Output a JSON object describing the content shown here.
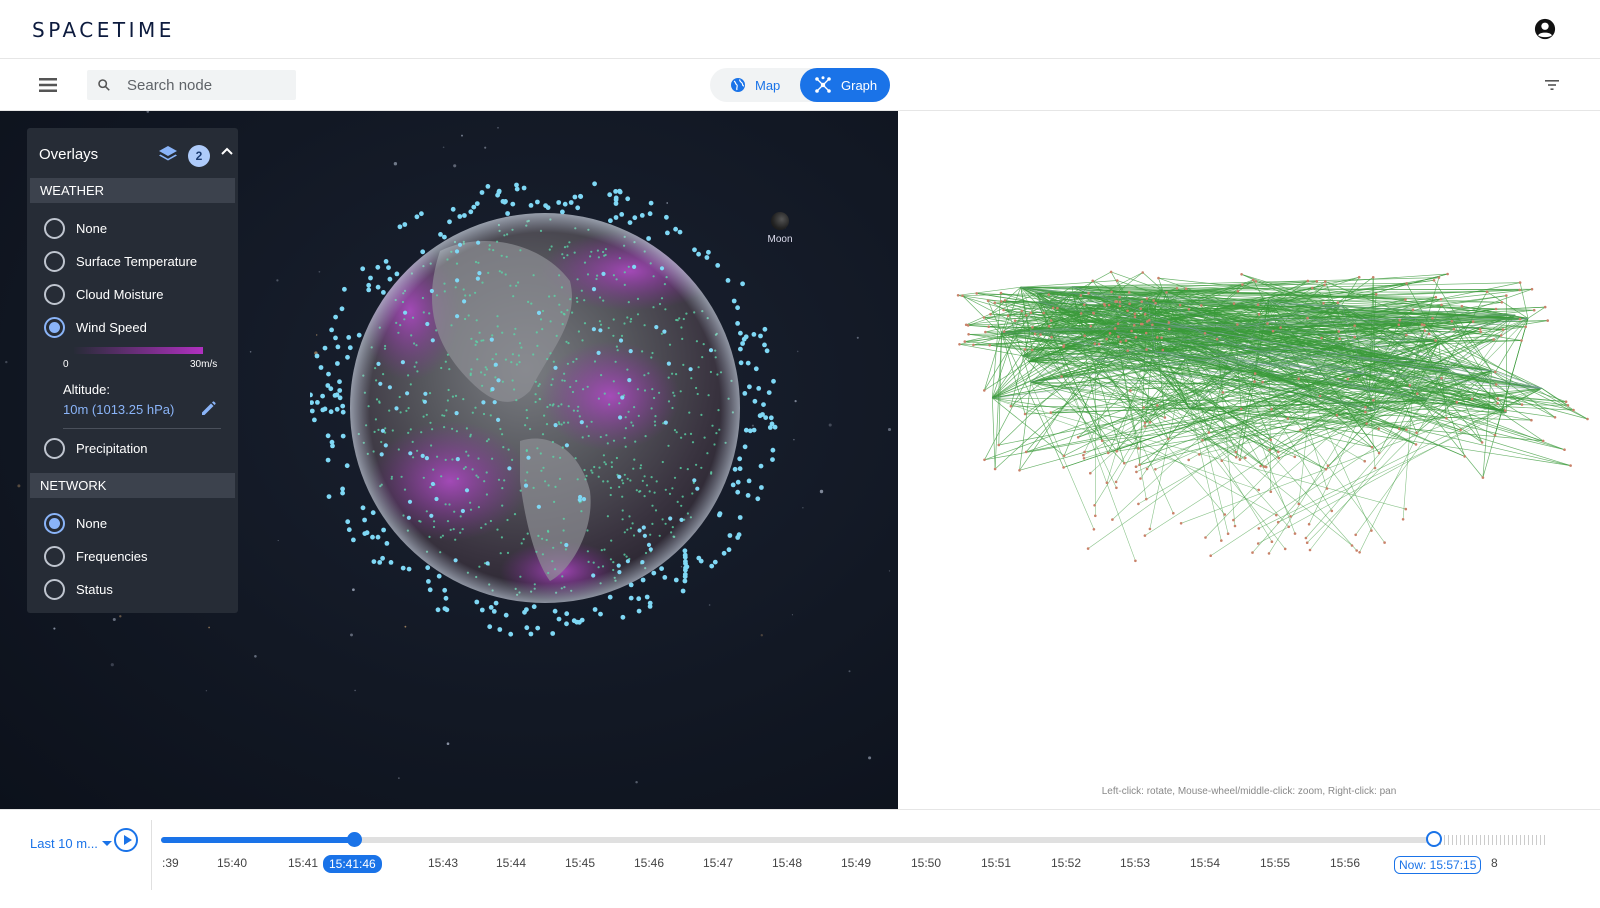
{
  "app": {
    "logo": "SPACETIME"
  },
  "toolbar": {
    "search_placeholder": "Search node",
    "view_toggle": {
      "map_label": "Map",
      "graph_label": "Graph",
      "active": "Graph"
    }
  },
  "overlays": {
    "title": "Overlays",
    "active_count": "2",
    "weather": {
      "heading": "WEATHER",
      "options": [
        "None",
        "Surface Temperature",
        "Cloud Moisture",
        "Wind Speed",
        "Precipitation"
      ],
      "selected": "Wind Speed",
      "scale_min": "0",
      "scale_max": "30m/s",
      "altitude_label": "Altitude:",
      "altitude_value": "10m (1013.25 hPa)"
    },
    "network": {
      "heading": "NETWORK",
      "options": [
        "None",
        "Frequencies",
        "Status"
      ],
      "selected": "None"
    }
  },
  "map": {
    "moon_label": "Moon"
  },
  "graph": {
    "hint": "Left-click: rotate, Mouse-wheel/middle-click: zoom, Right-click: pan"
  },
  "timeline": {
    "range_label": "Last 10 m...",
    "ticks": [
      ":39",
      "15:40",
      "15:41",
      "15:43",
      "15:44",
      "15:45",
      "15:46",
      "15:47",
      "15:48",
      "15:49",
      "15:50",
      "15:51",
      "15:52",
      "15:53",
      "15:54",
      "15:55",
      "15:56",
      "8"
    ],
    "current_time": "15:41:46",
    "now_label": "Now: 15:57:15",
    "progress_fraction": 0.15
  },
  "colors": {
    "accent": "#1a73e8",
    "panel_bg": "#262c36",
    "space_bg": "#121824",
    "graph_edge": "#3a9a3a",
    "satellite": "#7fd8f5",
    "wind": "#b030c0"
  }
}
